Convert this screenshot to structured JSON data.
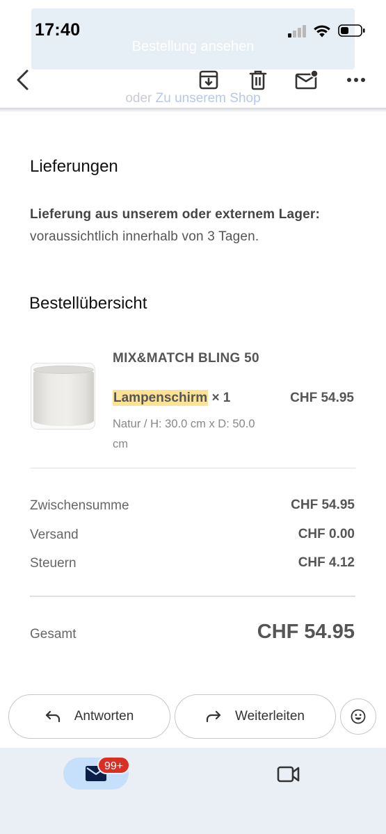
{
  "status_bar": {
    "time": "17:40"
  },
  "behind_content": {
    "button_label": "Bestellung ansehen",
    "link_prefix": "oder",
    "link_text": "Zu unserem Shop"
  },
  "toolbar": {
    "icons": [
      "back-arrow-icon",
      "archive-icon",
      "trash-icon",
      "mark-unread-icon",
      "more-icon"
    ]
  },
  "deliveries": {
    "heading": "Lieferungen",
    "bold_text": "Lieferung aus unserem oder externem Lager:",
    "text": "voraussichtlich innerhalb von 3 Tagen."
  },
  "order": {
    "heading": "Bestellübersicht",
    "item": {
      "name": "MIX&MATCH BLING 50",
      "type_highlighted": "Lampenschirm",
      "quantity": "× 1",
      "price": "CHF 54.95",
      "variant": "Natur / H: 30.0 cm x D: 50.0 cm"
    },
    "summary": [
      {
        "label": "Zwischensumme",
        "value": "CHF 54.95"
      },
      {
        "label": "Versand",
        "value": "CHF 0.00"
      },
      {
        "label": "Steuern",
        "value": "CHF 4.12"
      }
    ],
    "total": {
      "label": "Gesamt",
      "value": "CHF 54.95"
    }
  },
  "actions": {
    "reply": "Antworten",
    "forward": "Weiterleiten"
  },
  "bottom_nav": {
    "mail_badge": "99+"
  },
  "colors": {
    "highlight": "#fde293",
    "nav_active": "#c6e0fb",
    "badge": "#d93025",
    "bottom_nav_bg": "#eaeff6"
  }
}
